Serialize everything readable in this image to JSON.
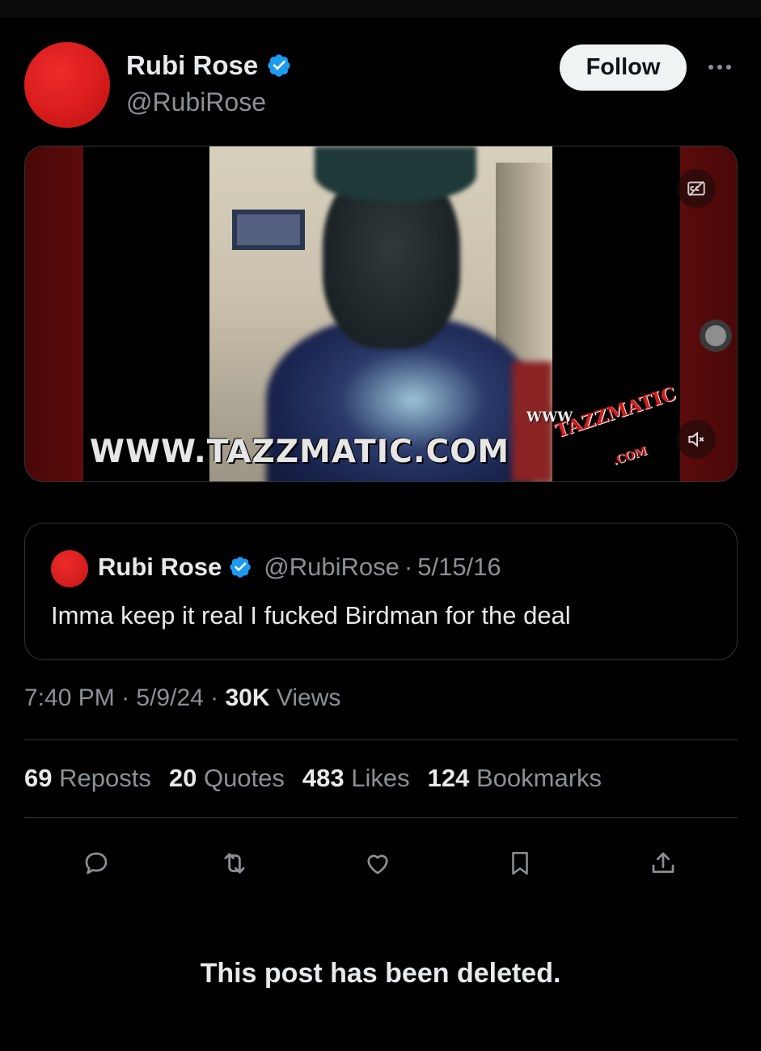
{
  "post": {
    "author": {
      "display_name": "Rubi Rose",
      "handle": "@RubiRose",
      "verified": true,
      "avatar_color": "#e02121"
    },
    "follow_label": "Follow",
    "more_icon": "more-horizontal-icon",
    "media": {
      "watermark_text": "WWW.TAZZMATIC.COM",
      "logo_www": "WWW.",
      "logo_main": "TAZZMATIC",
      "logo_com": ".COM",
      "captions_icon": "captions-off-icon",
      "mute_icon": "volume-muted-icon"
    },
    "quoted_post": {
      "display_name": "Rubi Rose",
      "handle": "@RubiRose",
      "date": "5/15/16",
      "separator": "·",
      "text": "Imma keep it real I fucked Birdman for the deal"
    },
    "time": "7:40 PM",
    "date": "5/9/24",
    "views_count": "30K",
    "views_label": "Views",
    "stats": [
      {
        "count": "69",
        "label": "Reposts"
      },
      {
        "count": "20",
        "label": "Quotes"
      },
      {
        "count": "483",
        "label": "Likes"
      },
      {
        "count": "124",
        "label": "Bookmarks"
      }
    ],
    "actions": [
      "reply-icon",
      "repost-icon",
      "like-icon",
      "bookmark-icon",
      "share-icon"
    ]
  },
  "deleted_notice": "This post has been deleted.",
  "colors": {
    "background": "#000000",
    "text_primary": "#e7e9ea",
    "text_secondary": "#8b9096",
    "verified_blue": "#1d9bf0",
    "border": "#2f3336"
  }
}
